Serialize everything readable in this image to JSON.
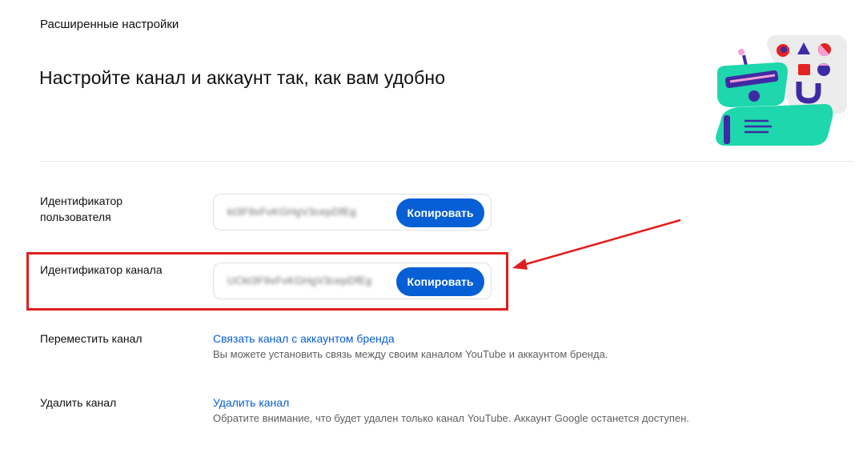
{
  "page": {
    "section_title": "Расширенные настройки",
    "heading": "Настройте канал и аккаунт так, как вам удобно"
  },
  "user_id": {
    "label": "Идентификатор\nпользователя",
    "value": "kt3F9xFvKGHgV3cepDfEg",
    "copy_label": "Копировать"
  },
  "channel_id": {
    "label": "Идентификатор канала",
    "value": "UCkt3F9xFvKGHgV3cepDfEg",
    "copy_label": "Копировать"
  },
  "move_channel": {
    "label": "Переместить канал",
    "link": "Связать канал с аккаунтом бренда",
    "description": "Вы можете установить связь между своим каналом YouTube и аккаунтом бренда."
  },
  "delete_channel": {
    "label": "Удалить канал",
    "link": "Удалить канал",
    "description": "Обратите внимание, что будет удален только канал YouTube. Аккаунт Google останется доступен."
  },
  "colors": {
    "accent_blue": "#065fd4",
    "annotation_red": "#e01e1e",
    "illustration_teal": "#1ed7ac",
    "illustration_purple": "#3f2aa5"
  }
}
